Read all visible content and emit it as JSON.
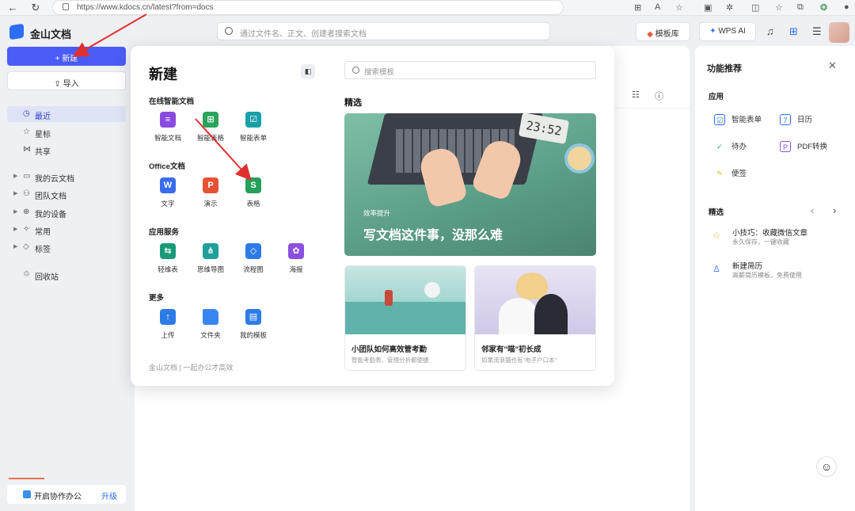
{
  "browser": {
    "url": "https://www.kdocs.cn/latest?from=docs",
    "url_icons": [
      "grid-icon",
      "translate-icon",
      "star-icon"
    ],
    "right_icons": [
      "split-view-icon",
      "extensions-icon",
      "reading-view-icon",
      "favorites-icon",
      "collections-icon",
      "copilot-icon",
      "profile-icon"
    ]
  },
  "app": {
    "name": "金山文档",
    "search_placeholder": "通过文件名、正文、创建者搜索文档",
    "template_button": "模板库",
    "ai_button": "WPS AI"
  },
  "sidebar": {
    "new_label": "+ 新建",
    "import_label": "导入",
    "items": [
      {
        "label": "最近",
        "icon": "clock-icon",
        "active": true
      },
      {
        "label": "星标",
        "icon": "star-icon"
      },
      {
        "label": "共享",
        "icon": "share-icon"
      },
      {
        "label": "我的云文档",
        "icon": "folder-icon",
        "expandable": true
      },
      {
        "label": "团队文档",
        "icon": "team-icon",
        "expandable": true
      },
      {
        "label": "我的设备",
        "icon": "device-icon",
        "expandable": true
      },
      {
        "label": "常用",
        "icon": "pin-icon",
        "expandable": true
      },
      {
        "label": "标签",
        "icon": "tag-icon",
        "expandable": true
      },
      {
        "label": "回收站",
        "icon": "trash-icon"
      }
    ],
    "collab_label": "开启协作办公",
    "upgrade_label": "升级"
  },
  "popup": {
    "title": "新建",
    "sections": [
      {
        "title": "在线智能文档",
        "items": [
          {
            "label": "智能文档",
            "glyph": "≡",
            "color": "#8a4be0"
          },
          {
            "label": "智能表格",
            "glyph": "⊞",
            "color": "#2aa45c"
          },
          {
            "label": "智能表单",
            "glyph": "☑",
            "color": "#1a9fa8"
          }
        ]
      },
      {
        "title": "Office文档",
        "items": [
          {
            "label": "文字",
            "glyph": "W",
            "color": "#3a6cf0"
          },
          {
            "label": "演示",
            "glyph": "P",
            "color": "#e55333"
          },
          {
            "label": "表格",
            "glyph": "S",
            "color": "#26a05a"
          }
        ]
      },
      {
        "title": "应用服务",
        "items": [
          {
            "label": "轻维表",
            "glyph": "⇆",
            "color": "#1a9a7a"
          },
          {
            "label": "思维导图",
            "glyph": "⋔",
            "color": "#1fa09a"
          },
          {
            "label": "流程图",
            "glyph": "◇",
            "color": "#2e7be8"
          },
          {
            "label": "海报",
            "glyph": "✿",
            "color": "#8a50e0"
          }
        ]
      },
      {
        "title": "更多",
        "items": [
          {
            "label": "上传",
            "glyph": "↑",
            "color": "#2e7be8"
          },
          {
            "label": "文件夹",
            "glyph": "",
            "color": "#3a86f0"
          },
          {
            "label": "我的模板",
            "glyph": "▤",
            "color": "#2e7be8"
          }
        ]
      }
    ],
    "footer": "金山文档 | 一起办公才高效",
    "template_search_placeholder": "搜索模板",
    "featured_title": "精选",
    "banner": {
      "subtitle": "效率提升",
      "title": "写文档这件事，没那么难",
      "clock": "23:52"
    },
    "cards": [
      {
        "title": "小团队如何高效管考勤",
        "subtitle": "智能考勤表、管理分析都便捷"
      },
      {
        "title": "邻家有\"喵\"初长成",
        "subtitle": "如果流浪猫也有\"电子户口本\""
      }
    ]
  },
  "right_panel": {
    "title": "功能推荐",
    "apps_title": "应用",
    "apps": [
      {
        "label": "智能表单",
        "glyph": "☑",
        "color": "#2e6ef5"
      },
      {
        "label": "日历",
        "glyph": "7",
        "color": "#2e6ef5"
      },
      {
        "label": "待办",
        "glyph": "✓",
        "color": "#1aa89a"
      },
      {
        "label": "PDF转换",
        "glyph": "P",
        "color": "#8a50e0"
      },
      {
        "label": "便签",
        "glyph": "✎",
        "color": "#c9c020"
      }
    ],
    "featured_title": "精选",
    "features": [
      {
        "title": "小技巧：收藏微信文章",
        "subtitle": "永久保存，一键收藏",
        "glyph": "☆",
        "color": "#e8b020"
      },
      {
        "title": "新建简历",
        "subtitle": "高薪简历模板，免费使用",
        "glyph": "♙",
        "color": "#2e6ef5"
      }
    ]
  },
  "colors": {
    "accent": "#4a5cf5",
    "annotation_arrow": "#e03030"
  }
}
